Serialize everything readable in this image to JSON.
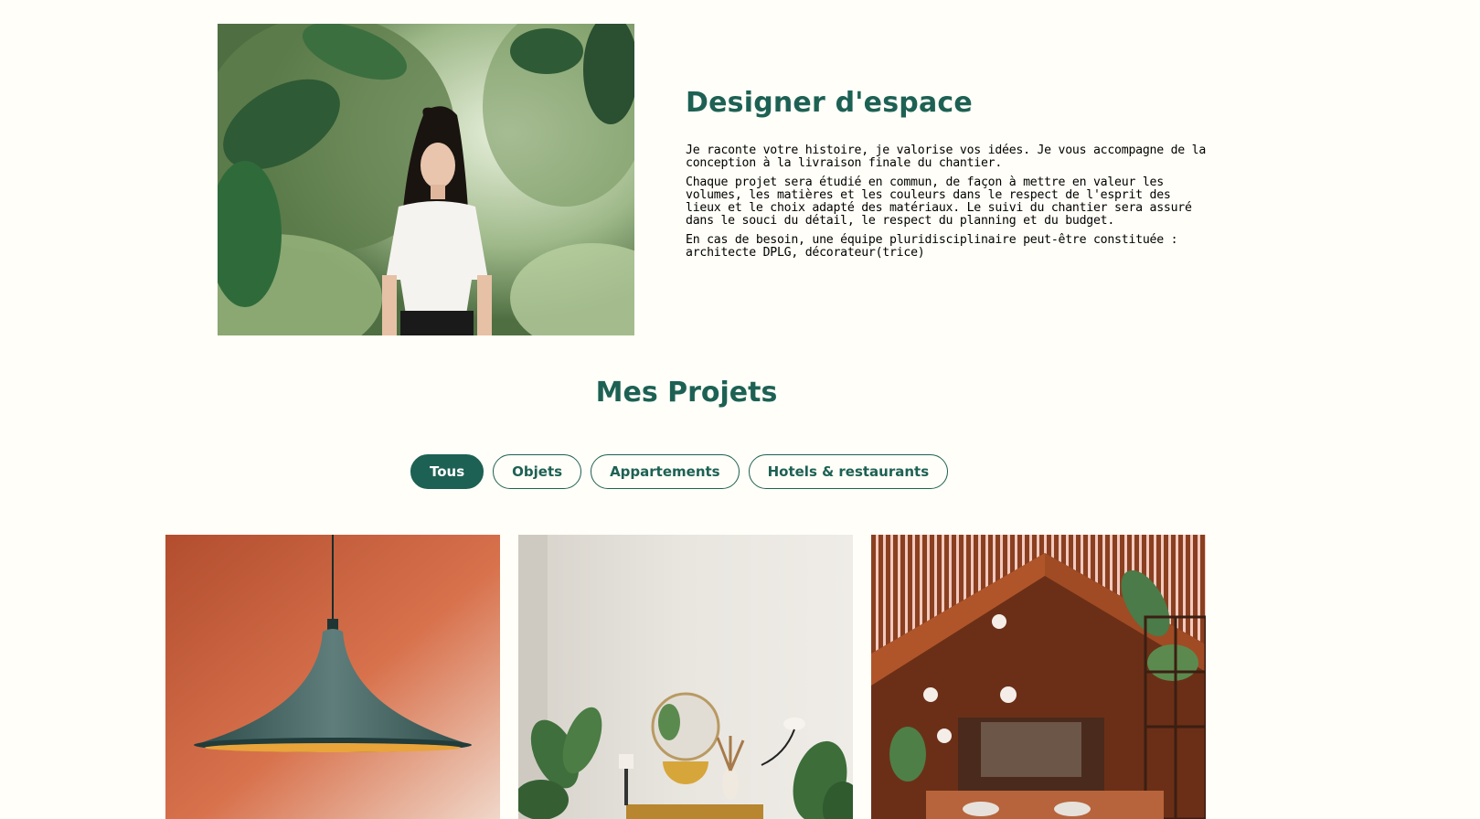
{
  "about": {
    "title": "Designer d'espace",
    "paragraphs": [
      "Je raconte votre histoire, je valorise vos idées. Je vous accompagne de la conception à la livraison finale du chantier.",
      "Chaque projet sera étudié en commun, de façon à mettre en valeur les volumes, les matières et les couleurs dans le respect de l'esprit des lieux et le choix adapté des matériaux. Le suivi du chantier sera assuré dans le souci du détail, le respect du planning et du budget.",
      "En cas de besoin, une équipe pluridisciplinaire peut-être constituée : architecte DPLG, décorateur(trice)"
    ]
  },
  "projects": {
    "title": "Mes Projets",
    "filters": [
      "Tous",
      "Objets",
      "Appartements",
      "Hotels & restaurants"
    ],
    "active_filter": "Tous"
  },
  "colors": {
    "accent": "#1d6154",
    "background": "#fffef8"
  }
}
